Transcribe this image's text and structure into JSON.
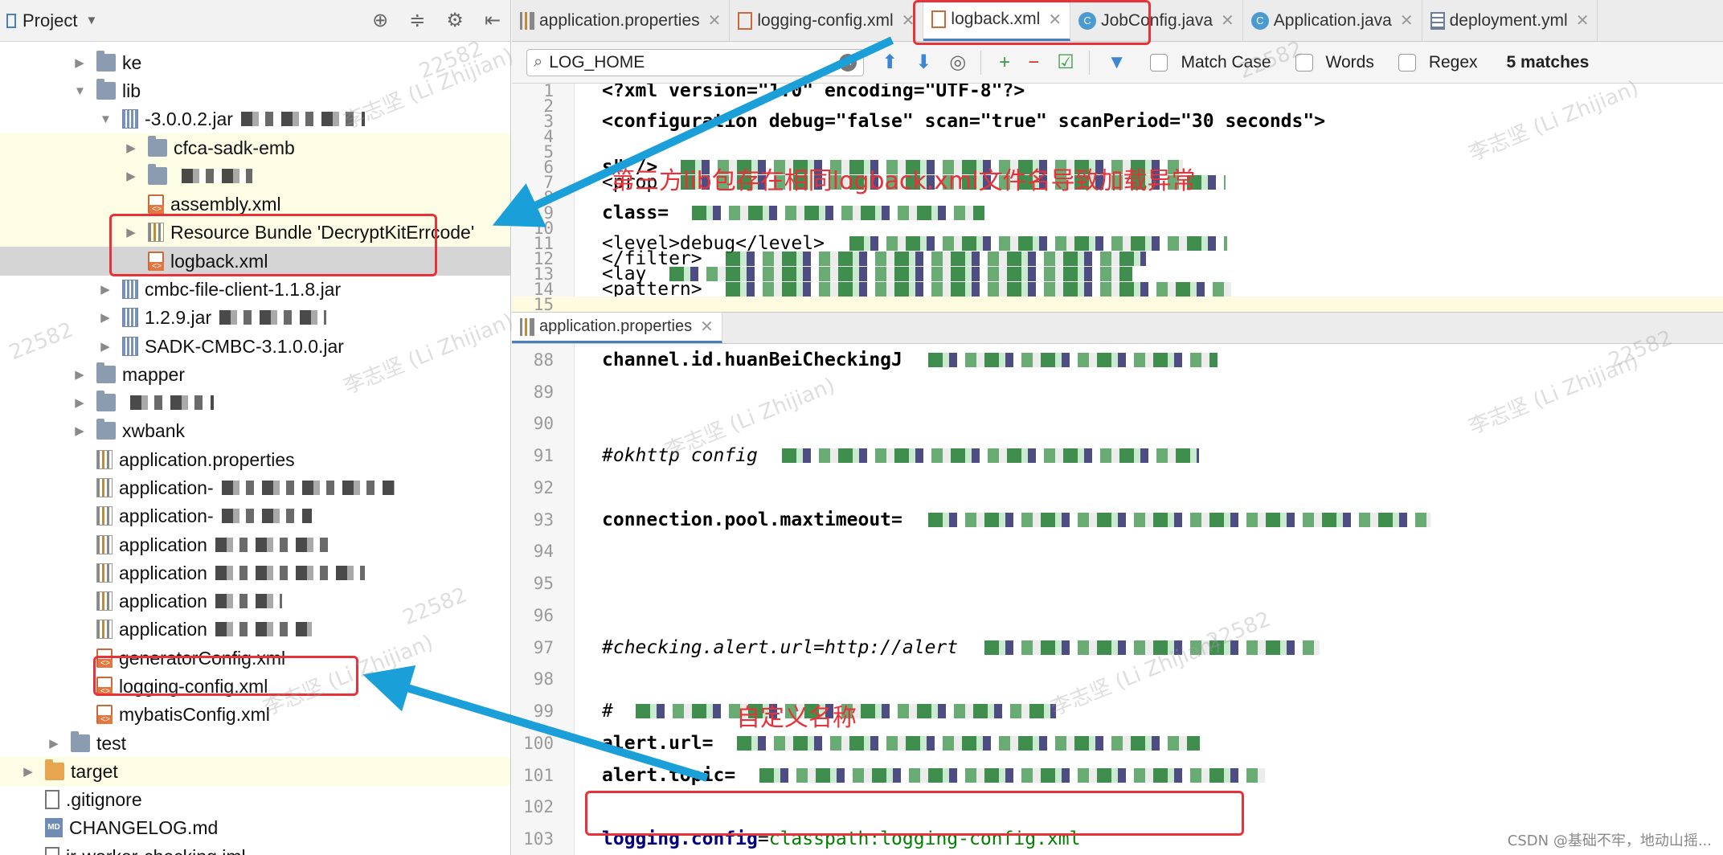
{
  "project_panel": {
    "title": "Project",
    "tree": [
      {
        "label": "ke",
        "type": "folder",
        "indent": 1,
        "arrow": "right"
      },
      {
        "label": "lib",
        "type": "folder",
        "indent": 1,
        "arrow": "down"
      },
      {
        "label": "-3.0.0.2.jar",
        "type": "jar",
        "indent": 2,
        "arrow": "down"
      },
      {
        "label": "cfca-sadk-emb",
        "type": "folder",
        "indent": 3,
        "arrow": "right",
        "yellow": true
      },
      {
        "label": "",
        "type": "folder",
        "indent": 3,
        "arrow": "right",
        "yellow": true
      },
      {
        "label": "assembly.xml",
        "type": "xml",
        "indent": 3,
        "arrow": "",
        "yellow": true
      },
      {
        "label": "Resource Bundle 'DecryptKitErrcode'",
        "type": "props",
        "indent": 3,
        "arrow": "right",
        "yellow": true
      },
      {
        "label": "logback.xml",
        "type": "xml",
        "indent": 3,
        "arrow": "",
        "selected": true
      },
      {
        "label": "cmbc-file-client-1.1.8.jar",
        "type": "jar",
        "indent": 2,
        "arrow": "right"
      },
      {
        "label": "1.2.9.jar",
        "type": "jar",
        "indent": 2,
        "arrow": "right"
      },
      {
        "label": "SADK-CMBC-3.1.0.0.jar",
        "type": "jar",
        "indent": 2,
        "arrow": "right"
      },
      {
        "label": "mapper",
        "type": "folder",
        "indent": 1,
        "arrow": "right"
      },
      {
        "label": "",
        "type": "folder",
        "indent": 1,
        "arrow": "right"
      },
      {
        "label": "xwbank",
        "type": "folder",
        "indent": 1,
        "arrow": "right"
      },
      {
        "label": "application.properties",
        "type": "props",
        "indent": 1,
        "arrow": ""
      },
      {
        "label": "application-",
        "type": "props",
        "indent": 1,
        "arrow": ""
      },
      {
        "label": "application-",
        "type": "props",
        "indent": 1,
        "arrow": ""
      },
      {
        "label": "application",
        "type": "props",
        "indent": 1,
        "arrow": ""
      },
      {
        "label": "application",
        "type": "props",
        "indent": 1,
        "arrow": ""
      },
      {
        "label": "application",
        "type": "props",
        "indent": 1,
        "arrow": ""
      },
      {
        "label": "application",
        "type": "props",
        "indent": 1,
        "arrow": ""
      },
      {
        "label": "generatorConfig.xml",
        "type": "xml",
        "indent": 1,
        "arrow": ""
      },
      {
        "label": "logging-config.xml",
        "type": "xml",
        "indent": 1,
        "arrow": ""
      },
      {
        "label": "mybatisConfig.xml",
        "type": "xml",
        "indent": 1,
        "arrow": ""
      },
      {
        "label": "test",
        "type": "folder",
        "indent": 0,
        "arrow": "right"
      },
      {
        "label": "target",
        "type": "folder-orange",
        "indent": -1,
        "arrow": "right",
        "yellow": true
      },
      {
        "label": ".gitignore",
        "type": "file",
        "indent": -1,
        "arrow": ""
      },
      {
        "label": "CHANGELOG.md",
        "type": "md",
        "indent": -1,
        "arrow": ""
      },
      {
        "label": "ir-worker-checking.iml",
        "type": "file",
        "indent": -1,
        "arrow": ""
      }
    ]
  },
  "tabs": [
    {
      "label": "application.properties",
      "icon": "props"
    },
    {
      "label": "logging-config.xml",
      "icon": "xml"
    },
    {
      "label": "logback.xml",
      "icon": "xml",
      "active": true
    },
    {
      "label": "JobConfig.java",
      "icon": "java"
    },
    {
      "label": "Application.java",
      "icon": "java"
    },
    {
      "label": "deployment.yml",
      "icon": "yml"
    }
  ],
  "search": {
    "query": "LOG_HOME",
    "match_case": "Match Case",
    "words": "Words",
    "regex": "Regex",
    "matches": "5 matches"
  },
  "editor_top": {
    "lines": [
      {
        "n": "1",
        "html": "xmldecl"
      },
      {
        "n": "2"
      },
      {
        "n": "3",
        "html": "config"
      },
      {
        "n": "4"
      },
      {
        "n": "5"
      },
      {
        "n": "6",
        "text": "s\" />"
      },
      {
        "n": "7",
        "text": "<prop"
      },
      {
        "n": "8"
      },
      {
        "n": "9",
        "text": "class="
      },
      {
        "n": "10"
      },
      {
        "n": "11",
        "text": "<level>debug</level>"
      },
      {
        "n": "12",
        "text": "</filter>"
      },
      {
        "n": "13",
        "text": "<lay"
      },
      {
        "n": "14",
        "text": "<pattern>"
      },
      {
        "n": "15",
        "hl": true
      }
    ],
    "xml_decl": "<?xml version=\"1.0\" encoding=\"UTF-8\"?>",
    "config_line": "<configuration debug=\"false\" scan=\"true\" scanPeriod=\"30 seconds\">"
  },
  "split_tab": {
    "label": "application.properties"
  },
  "editor_bottom": {
    "lines": [
      {
        "n": "88",
        "text": "channel.id.huanBeiCheckingJ"
      },
      {
        "n": "89"
      },
      {
        "n": "90"
      },
      {
        "n": "91",
        "text": "#okhttp config"
      },
      {
        "n": "92"
      },
      {
        "n": "93",
        "text": "connection.pool.maxtimeout="
      },
      {
        "n": "94"
      },
      {
        "n": "95"
      },
      {
        "n": "96"
      },
      {
        "n": "97",
        "text": "#checking.alert.url=http://alert"
      },
      {
        "n": "98"
      },
      {
        "n": "99",
        "text": "#"
      },
      {
        "n": "100",
        "text": "alert.url="
      },
      {
        "n": "101",
        "text": "alert.topic="
      },
      {
        "n": "102"
      },
      {
        "n": "103",
        "key": "logging.config",
        "val": "classpath:logging-config.xml"
      }
    ]
  },
  "annotations": {
    "note_lib": "第三方lib包存在相同logback.xml文件名导致加载异常",
    "note_custom": "自定义名称"
  },
  "watermark": {
    "id": "22582",
    "name": "李志坚 (Li Zhijian)"
  },
  "footer": {
    "csdn": "CSDN @基础不牢，地动山摇..."
  },
  "colors": {
    "accent_red": "#e8323a",
    "arrow_blue": "#1a9fd8",
    "active_tab": "#4a7fbe"
  }
}
